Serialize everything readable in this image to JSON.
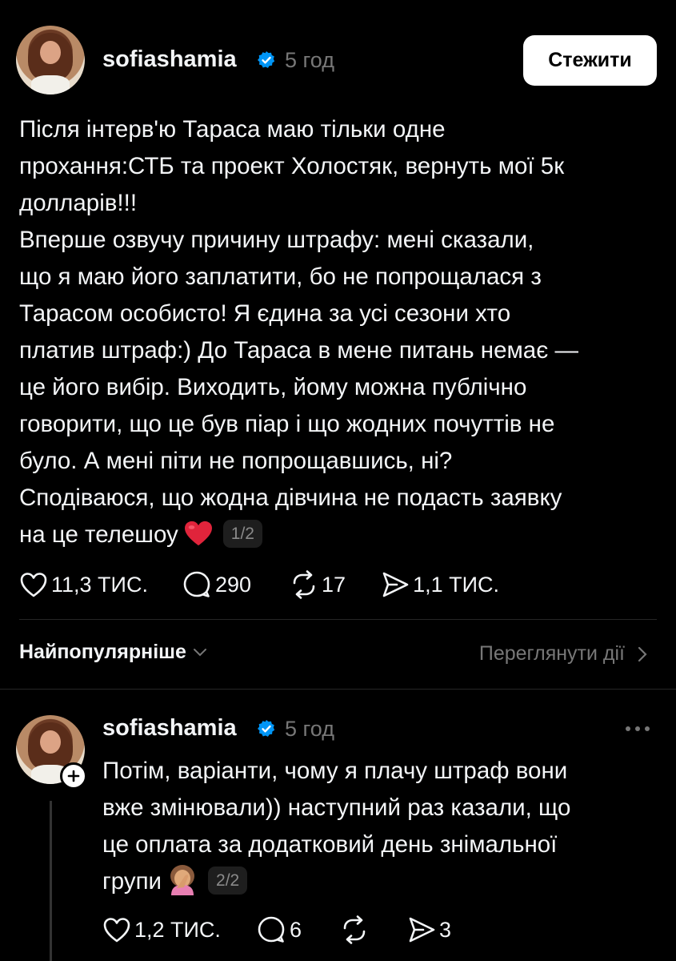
{
  "post": {
    "username": "sofiashamia",
    "time": "5 год",
    "follow_label": "Стежити",
    "lines": [
      "Після інтерв'ю Тараса маю тільки одне",
      "прохання:СТБ та проект Холостяк, вернуть мої 5к",
      "долларів!!!",
      "Вперше озвучу причину штрафу: мені сказали,",
      "що я маю його заплатити, бо не попрощалася з",
      "Тарасом особисто! Я єдина за усі сезони хто",
      "платив штраф:) До Тараса в мене питань немає —",
      "це його вибір. Виходить, йому можна публічно",
      "говорити, що це був піар і що жодних почуттів не",
      "було. А мені піти не попрощавшись, ні?",
      "Сподіваюся, що жодна дівчина не подасть заявку",
      "на це телешоу"
    ],
    "pager": "1/2",
    "likes": "11,3 ТИС.",
    "comments": "290",
    "reposts": "17",
    "shares": "1,1 ТИС.",
    "emoji": "heart-emoji"
  },
  "sort": {
    "label": "Найпопулярніше",
    "view_activity": "Переглянути дії"
  },
  "reply": {
    "username": "sofiashamia",
    "time": "5 год",
    "lines": [
      "Потім, варіанти, чому я плачу штраф вони",
      "вже змінювали)) наступний раз казали, що",
      "це оплата за додатковий день знімальної",
      "групи"
    ],
    "pager": "2/2",
    "likes": "1,2 ТИС.",
    "comments": "6",
    "reposts": "",
    "shares": "3",
    "emoji": "facepalm-emoji"
  },
  "colors": {
    "background": "#000000",
    "text": "#f3f5f7",
    "muted": "#777777",
    "verified": "#0095f6",
    "heart": "#e0243b"
  }
}
